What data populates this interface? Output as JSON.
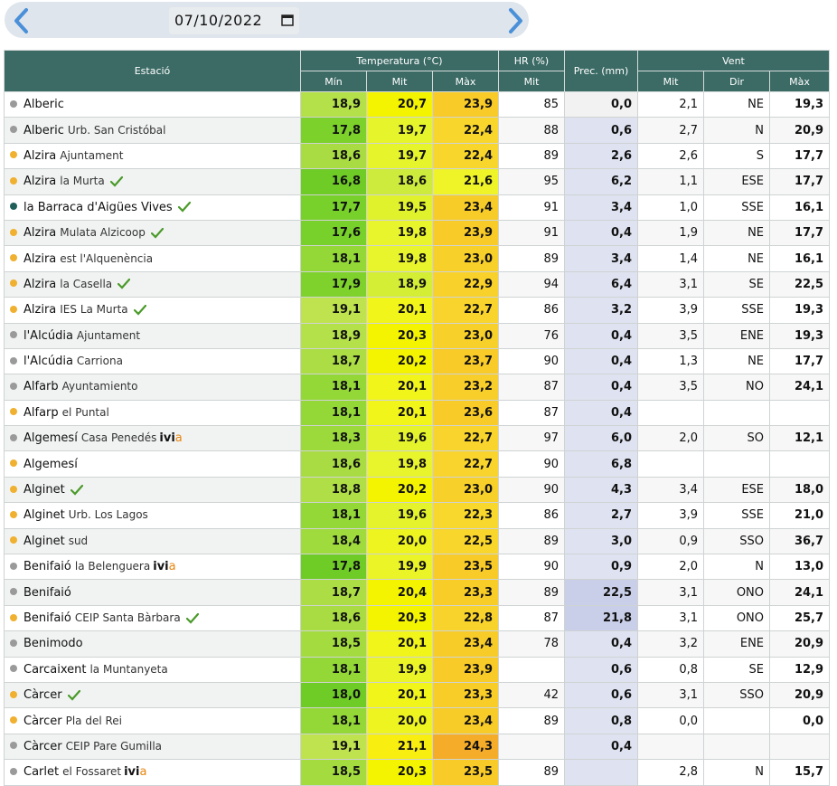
{
  "date": "07/10/2022",
  "headers": {
    "station": "Estació",
    "temperature": "Temperatura (°C)",
    "hr": "HR (%)",
    "prec": "Prec. (mm)",
    "wind": "Vent",
    "t_min": "Mín",
    "t_mit": "Mit",
    "t_max": "Màx",
    "hr_mit": "Mit",
    "w_mit": "Mit",
    "w_dir": "Dir",
    "w_max": "Màx"
  },
  "rows": [
    {
      "name": "Alberic",
      "sub": "",
      "dot": "#9a9a9a",
      "check": false,
      "ivia": false,
      "min": "18,9",
      "mit": "20,7",
      "max": "23,9",
      "hr": "85",
      "prec": "0,0",
      "wmit": "2,1",
      "wdir": "NE",
      "wmax": "19,3",
      "cmin": "#b4e04a",
      "cmit": "#f4f400",
      "cmax": "#f8cb28",
      "cprec": "#f2f2f2"
    },
    {
      "name": "Alberic",
      "sub": "Urb. San Cristóbal",
      "dot": "#9a9a9a",
      "check": false,
      "ivia": false,
      "min": "17,8",
      "mit": "19,7",
      "max": "22,4",
      "hr": "88",
      "prec": "0,6",
      "wmit": "2,7",
      "wdir": "N",
      "wmax": "20,9",
      "cmin": "#7cd12a",
      "cmit": "#e6f42c",
      "cmax": "#f8d62c",
      "cprec": "#dfe3f1"
    },
    {
      "name": "Alzira",
      "sub": "Ajuntament",
      "dot": "#f0b030",
      "check": false,
      "ivia": false,
      "min": "18,6",
      "mit": "19,7",
      "max": "22,4",
      "hr": "89",
      "prec": "2,6",
      "wmit": "2,6",
      "wdir": "S",
      "wmax": "17,7",
      "cmin": "#a8dc42",
      "cmit": "#e6f42c",
      "cmax": "#f8d62c",
      "cprec": "#dfe3f1"
    },
    {
      "name": "Alzira",
      "sub": "la Murta",
      "dot": "#f0b030",
      "check": true,
      "ivia": false,
      "min": "16,8",
      "mit": "18,6",
      "max": "21,6",
      "hr": "95",
      "prec": "6,2",
      "wmit": "1,1",
      "wdir": "ESE",
      "wmax": "17,7",
      "cmin": "#6fcb26",
      "cmit": "#cdeb3c",
      "cmax": "#eef428",
      "cprec": "#dfe3f1"
    },
    {
      "name": "la Barraca d'Aigües Vives",
      "sub": "",
      "dot": "#1f5f5a",
      "check": true,
      "ivia": false,
      "min": "17,7",
      "mit": "19,5",
      "max": "23,4",
      "hr": "91",
      "prec": "3,4",
      "wmit": "1,0",
      "wdir": "SSE",
      "wmax": "16,1",
      "cmin": "#78d02a",
      "cmit": "#e0f22c",
      "cmax": "#f8cc28",
      "cprec": "#dfe3f1"
    },
    {
      "name": "Alzira",
      "sub": "Mulata Alzicoop",
      "dot": "#f0b030",
      "check": true,
      "ivia": false,
      "min": "17,6",
      "mit": "19,8",
      "max": "23,9",
      "hr": "91",
      "prec": "0,4",
      "wmit": "1,9",
      "wdir": "NE",
      "wmax": "17,7",
      "cmin": "#78d02a",
      "cmit": "#e8f42c",
      "cmax": "#f8cb28",
      "cprec": "#dfe3f1"
    },
    {
      "name": "Alzira",
      "sub": "est l'Alquenència",
      "dot": "#f0b030",
      "check": false,
      "ivia": false,
      "min": "18,1",
      "mit": "19,8",
      "max": "23,0",
      "hr": "89",
      "prec": "3,4",
      "wmit": "1,4",
      "wdir": "NE",
      "wmax": "16,1",
      "cmin": "#94d838",
      "cmit": "#e8f42c",
      "cmax": "#f8d02a",
      "cprec": "#dfe3f1"
    },
    {
      "name": "Alzira",
      "sub": "la Casella",
      "dot": "#f0b030",
      "check": true,
      "ivia": false,
      "min": "17,9",
      "mit": "18,9",
      "max": "22,9",
      "hr": "94",
      "prec": "6,4",
      "wmit": "3,1",
      "wdir": "SE",
      "wmax": "22,5",
      "cmin": "#7fd22c",
      "cmit": "#d4ee36",
      "cmax": "#f8d22a",
      "cprec": "#dfe3f1"
    },
    {
      "name": "Alzira",
      "sub": "IES La Murta",
      "dot": "#f0b030",
      "check": true,
      "ivia": false,
      "min": "19,1",
      "mit": "20,1",
      "max": "22,7",
      "hr": "86",
      "prec": "3,2",
      "wmit": "3,9",
      "wdir": "SSE",
      "wmax": "19,3",
      "cmin": "#bfe34e",
      "cmit": "#f2f51a",
      "cmax": "#f8d42c",
      "cprec": "#dfe3f1"
    },
    {
      "name": "l'Alcúdia",
      "sub": "Ajuntament",
      "dot": "#9a9a9a",
      "check": false,
      "ivia": false,
      "min": "18,9",
      "mit": "20,3",
      "max": "23,0",
      "hr": "76",
      "prec": "0,4",
      "wmit": "3,5",
      "wdir": "ENE",
      "wmax": "19,3",
      "cmin": "#b4e04a",
      "cmit": "#f4f400",
      "cmax": "#f8d02a",
      "cprec": "#dfe3f1"
    },
    {
      "name": "l'Alcúdia",
      "sub": "Carriona",
      "dot": "#9a9a9a",
      "check": false,
      "ivia": false,
      "min": "18,7",
      "mit": "20,2",
      "max": "23,7",
      "hr": "90",
      "prec": "0,4",
      "wmit": "1,3",
      "wdir": "NE",
      "wmax": "17,7",
      "cmin": "#acdd44",
      "cmit": "#f4f400",
      "cmax": "#f8cb28",
      "cprec": "#dfe3f1"
    },
    {
      "name": "Alfarb",
      "sub": "Ayuntamiento",
      "dot": "#9a9a9a",
      "check": false,
      "ivia": false,
      "min": "18,1",
      "mit": "20,1",
      "max": "23,2",
      "hr": "87",
      "prec": "0,4",
      "wmit": "3,5",
      "wdir": "NO",
      "wmax": "24,1",
      "cmin": "#94d838",
      "cmit": "#f2f51a",
      "cmax": "#f8ce2a",
      "cprec": "#dfe3f1"
    },
    {
      "name": "Alfarp",
      "sub": "el Puntal",
      "dot": "#f0b030",
      "check": false,
      "ivia": false,
      "min": "18,1",
      "mit": "20,1",
      "max": "23,6",
      "hr": "87",
      "prec": "0,4",
      "wmit": "",
      "wdir": "",
      "wmax": "",
      "cmin": "#94d838",
      "cmit": "#f2f51a",
      "cmax": "#f8cb28",
      "cprec": "#dfe3f1"
    },
    {
      "name": "Algemesí",
      "sub": "Casa Penedés",
      "dot": "#9a9a9a",
      "check": false,
      "ivia": true,
      "min": "18,3",
      "mit": "19,6",
      "max": "22,7",
      "hr": "97",
      "prec": "6,0",
      "wmit": "2,0",
      "wdir": "SO",
      "wmax": "12,1",
      "cmin": "#9cda3c",
      "cmit": "#e4f32c",
      "cmax": "#f8d42c",
      "cprec": "#dfe3f1"
    },
    {
      "name": "Algemesí",
      "sub": "",
      "dot": "#f0b030",
      "check": false,
      "ivia": false,
      "min": "18,6",
      "mit": "19,8",
      "max": "22,7",
      "hr": "90",
      "prec": "6,8",
      "wmit": "",
      "wdir": "",
      "wmax": "",
      "cmin": "#a8dc42",
      "cmit": "#e8f42c",
      "cmax": "#f8d42c",
      "cprec": "#dfe3f1"
    },
    {
      "name": "Alginet",
      "sub": "",
      "dot": "#f0b030",
      "check": true,
      "ivia": false,
      "min": "18,8",
      "mit": "20,2",
      "max": "23,0",
      "hr": "90",
      "prec": "4,3",
      "wmit": "3,4",
      "wdir": "ESE",
      "wmax": "18,0",
      "cmin": "#b0de46",
      "cmit": "#f4f400",
      "cmax": "#f8d02a",
      "cprec": "#dfe3f1"
    },
    {
      "name": "Alginet",
      "sub": "Urb. Los Lagos",
      "dot": "#f0b030",
      "check": false,
      "ivia": false,
      "min": "18,1",
      "mit": "19,6",
      "max": "22,3",
      "hr": "86",
      "prec": "2,7",
      "wmit": "3,9",
      "wdir": "SSE",
      "wmax": "21,0",
      "cmin": "#94d838",
      "cmit": "#e4f32c",
      "cmax": "#f8d82c",
      "cprec": "#dfe3f1"
    },
    {
      "name": "Alginet",
      "sub": "sud",
      "dot": "#f0b030",
      "check": false,
      "ivia": false,
      "min": "18,4",
      "mit": "20,0",
      "max": "22,5",
      "hr": "89",
      "prec": "3,0",
      "wmit": "0,9",
      "wdir": "SSO",
      "wmax": "36,7",
      "cmin": "#a0db3e",
      "cmit": "#eef420",
      "cmax": "#f8d62c",
      "cprec": "#dfe3f1"
    },
    {
      "name": "Benifaió",
      "sub": "la Belenguera",
      "dot": "#9a9a9a",
      "check": false,
      "ivia": true,
      "min": "17,8",
      "mit": "19,9",
      "max": "23,5",
      "hr": "90",
      "prec": "0,9",
      "wmit": "2,0",
      "wdir": "N",
      "wmax": "13,0",
      "cmin": "#6fcb26",
      "cmit": "#eaf426",
      "cmax": "#f8cb28",
      "cprec": "#dfe3f1"
    },
    {
      "name": "Benifaió",
      "sub": "",
      "dot": "#9a9a9a",
      "check": false,
      "ivia": false,
      "min": "18,7",
      "mit": "20,4",
      "max": "23,3",
      "hr": "89",
      "prec": "22,5",
      "wmit": "3,1",
      "wdir": "ONO",
      "wmax": "24,1",
      "cmin": "#acdd44",
      "cmit": "#f4f400",
      "cmax": "#f8cd28",
      "cprec": "#c9cfe8"
    },
    {
      "name": "Benifaió",
      "sub": "CEIP Santa Bàrbara",
      "dot": "#f0b030",
      "check": true,
      "ivia": false,
      "min": "18,6",
      "mit": "20,3",
      "max": "22,8",
      "hr": "87",
      "prec": "21,8",
      "wmit": "3,1",
      "wdir": "ONO",
      "wmax": "25,7",
      "cmin": "#a8dc42",
      "cmit": "#f4f400",
      "cmax": "#f8d32c",
      "cprec": "#c9cfe8"
    },
    {
      "name": "Benimodo",
      "sub": "",
      "dot": "#9a9a9a",
      "check": false,
      "ivia": false,
      "min": "18,5",
      "mit": "20,1",
      "max": "23,4",
      "hr": "78",
      "prec": "0,4",
      "wmit": "3,2",
      "wdir": "ENE",
      "wmax": "20,9",
      "cmin": "#a4dc40",
      "cmit": "#f2f51a",
      "cmax": "#f8cc28",
      "cprec": "#dfe3f1"
    },
    {
      "name": "Carcaixent",
      "sub": "la Muntanyeta",
      "dot": "#9a9a9a",
      "check": false,
      "ivia": false,
      "min": "18,1",
      "mit": "19,9",
      "max": "23,9",
      "hr": "",
      "prec": "0,6",
      "wmit": "0,8",
      "wdir": "SE",
      "wmax": "12,9",
      "cmin": "#94d838",
      "cmit": "#eaf426",
      "cmax": "#f8cb28",
      "cprec": "#dfe3f1"
    },
    {
      "name": "Càrcer",
      "sub": "",
      "dot": "#f0b030",
      "check": true,
      "ivia": false,
      "min": "18,0",
      "mit": "20,1",
      "max": "23,3",
      "hr": "42",
      "prec": "0,6",
      "wmit": "3,1",
      "wdir": "SSO",
      "wmax": "20,9",
      "cmin": "#6fcb26",
      "cmit": "#f2f51a",
      "cmax": "#f8cd28",
      "cprec": "#dfe3f1"
    },
    {
      "name": "Càrcer",
      "sub": "Pla del Rei",
      "dot": "#f0b030",
      "check": false,
      "ivia": false,
      "min": "18,1",
      "mit": "20,0",
      "max": "23,4",
      "hr": "89",
      "prec": "0,8",
      "wmit": "0,0",
      "wdir": "",
      "wmax": "0,0",
      "cmin": "#94d838",
      "cmit": "#eef420",
      "cmax": "#f8cc28",
      "cprec": "#dfe3f1"
    },
    {
      "name": "Càrcer",
      "sub": "CEIP Pare Gumilla",
      "dot": "#9a9a9a",
      "check": false,
      "ivia": false,
      "min": "19,1",
      "mit": "21,1",
      "max": "24,3",
      "hr": "",
      "prec": "0,4",
      "wmit": "",
      "wdir": "",
      "wmax": "",
      "cmin": "#bfe34e",
      "cmit": "#f8ee10",
      "cmax": "#f5ac28",
      "cprec": "#dfe3f1"
    },
    {
      "name": "Carlet",
      "sub": "el Fossaret",
      "dot": "#9a9a9a",
      "check": false,
      "ivia": true,
      "min": "18,5",
      "mit": "20,3",
      "max": "23,5",
      "hr": "89",
      "prec": "",
      "wmit": "2,8",
      "wdir": "N",
      "wmax": "15,7",
      "cmin": "#a4dc40",
      "cmit": "#f4f400",
      "cmax": "#f8cb28",
      "cprec": "#dfe3f1"
    }
  ]
}
